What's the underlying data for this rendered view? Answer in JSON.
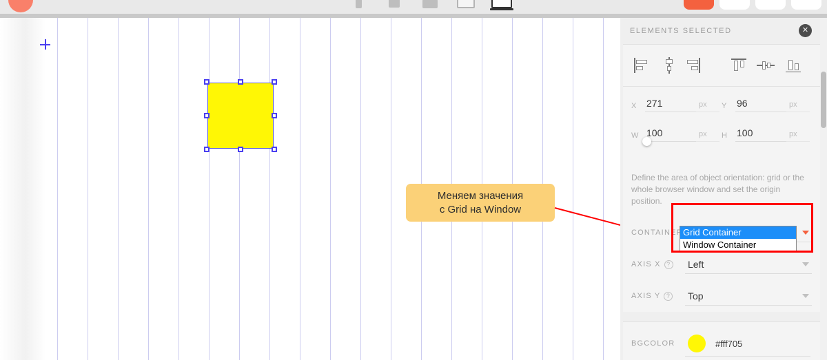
{
  "topbar": {
    "logo_name": "app-logo",
    "device_icons": [
      "phone-icon",
      "tablet-portrait-icon",
      "tablet-icon",
      "laptop-icon",
      "desktop-icon"
    ],
    "actions": [
      "publish-button",
      "preview-button",
      "settings-button",
      "account-button"
    ],
    "accent_color": "#f4613f"
  },
  "canvas": {
    "origin_marker": "origin-crosshair",
    "shape": {
      "name": "selected-rectangle",
      "fill": "#fff705",
      "handles": [
        "nw",
        "n",
        "ne",
        "w",
        "e",
        "sw",
        "s",
        "se"
      ]
    },
    "callout": {
      "text": "Меняем значения\nс Grid на Window",
      "bg": "#fbd178"
    },
    "arrow_color": "#ff0000"
  },
  "panel": {
    "title": "ELEMENTS SELECTED",
    "close_label": "✕",
    "align_buttons": [
      {
        "name": "align-left",
        "label": "Align left"
      },
      {
        "name": "align-center-horizontal",
        "label": "Align center horizontally"
      },
      {
        "name": "align-right",
        "label": "Align right"
      },
      {
        "name": "align-top",
        "label": "Align top"
      },
      {
        "name": "align-middle-vertical",
        "label": "Align middle vertically"
      },
      {
        "name": "align-bottom",
        "label": "Align bottom"
      }
    ],
    "coords": {
      "x_label": "X",
      "x_value": "271",
      "x_unit": "px",
      "y_label": "Y",
      "y_value": "96",
      "y_unit": "px",
      "w_label": "W",
      "w_value": "100",
      "w_unit": "px",
      "h_label": "H",
      "h_value": "100",
      "h_unit": "px"
    },
    "description": "Define the area of object orientation: grid or the whole browser window and set the origin position.",
    "container": {
      "label": "CONTAINER",
      "value": "Grid Container",
      "options": [
        "Grid Container",
        "Window Container"
      ],
      "selected_index": 0,
      "highlight_color": "#1c8ef9"
    },
    "axis_x": {
      "label": "AXIS X",
      "help": "?",
      "value": "Left"
    },
    "axis_y": {
      "label": "AXIS Y",
      "help": "?",
      "value": "Top"
    },
    "bgcolor": {
      "label": "BGCOLOR",
      "value": "#fff705",
      "swatch": "#fff705"
    }
  }
}
